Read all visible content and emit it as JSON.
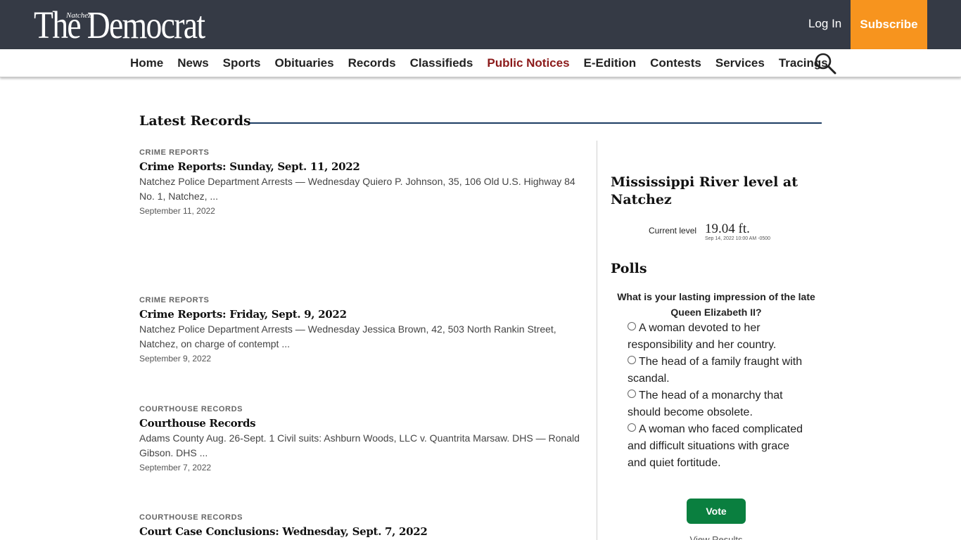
{
  "header": {
    "logo_small": "Natchez",
    "logo_main": "The Democrat",
    "login_label": "Log In",
    "subscribe_label": "Subscribe"
  },
  "nav": {
    "items": [
      "Home",
      "News",
      "Sports",
      "Obituaries",
      "Records",
      "Classifieds",
      "Public Notices",
      "E-Edition",
      "Contests",
      "Services",
      "Tracings"
    ],
    "active": "Public Notices"
  },
  "section": {
    "title": "Latest Records"
  },
  "articles": [
    {
      "category": "Crime Reports",
      "headline": "Crime Reports: Sunday, Sept. 11, 2022",
      "excerpt": "Natchez Police Department Arrests — Wednesday Quiero P. Johnson, 35, 106 Old U.S. Highway 84 No. 1, Natchez, ...",
      "date": "September 11, 2022"
    },
    {
      "category": "Crime Reports",
      "headline": "Crime Reports: Friday, Sept. 9, 2022",
      "excerpt": "Natchez Police Department Arrests — Wednesday Jessica Brown, 42, 503 North Rankin Street, Natchez, on charge of contempt ...",
      "date": "September 9, 2022"
    },
    {
      "category": "Courthouse Records",
      "headline": "Courthouse Records",
      "excerpt": "Adams County Aug. 26-Sept. 1 Civil suits: Ashburn Woods, LLC v. Quantrita Marsaw. DHS — Ronald Gibson. DHS ...",
      "date": "September 7, 2022"
    },
    {
      "category": "Courthouse Records",
      "headline": "Court Case Conclusions: Wednesday, Sept. 7, 2022",
      "excerpt": "",
      "date": ""
    }
  ],
  "sidebar": {
    "river": {
      "title": "Mississippi River level at Natchez",
      "label": "Current level",
      "value": "19.04 ft.",
      "timestamp": "Sep 14, 2022 10:00 AM -0500"
    },
    "polls": {
      "title": "Polls",
      "question": "What is your lasting impression of the late Queen Elizabeth II?",
      "options": [
        "A woman devoted to her responsibility and her country.",
        "The head of a family fraught with scandal.",
        "The head of a monarchy that should become obsolete.",
        "A woman who faced complicated and difficult situations with grace and quiet fortitude."
      ],
      "vote_label": "Vote",
      "view_results_label": "View Results"
    }
  },
  "colors": {
    "topbar": "#353a45",
    "subscribe": "#f7941e",
    "active_nav": "#8b1a1a",
    "section_rule": "#1c3d63",
    "vote_button": "#0a7f3f"
  }
}
